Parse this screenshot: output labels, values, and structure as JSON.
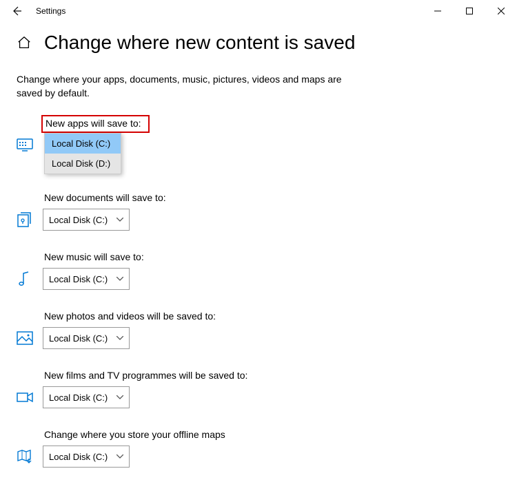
{
  "window": {
    "title": "Settings"
  },
  "page": {
    "heading": "Change where new content is saved",
    "description": "Change where your apps, documents, music, pictures, videos and maps are saved by default."
  },
  "sections": {
    "apps": {
      "label": "New apps will save to:",
      "value": "Local Disk (C:)"
    },
    "docs": {
      "label": "New documents will save to:",
      "value": "Local Disk (C:)"
    },
    "music": {
      "label": "New music will save to:",
      "value": "Local Disk (C:)"
    },
    "photos": {
      "label": "New photos and videos will be saved to:",
      "value": "Local Disk (C:)"
    },
    "films": {
      "label": "New films and TV programmes will be saved to:",
      "value": "Local Disk (C:)"
    },
    "maps": {
      "label": "Change where you store your offline maps",
      "value": "Local Disk (C:)"
    }
  },
  "dropdown": {
    "options": [
      "Local Disk (C:)",
      "Local Disk (D:)"
    ]
  }
}
